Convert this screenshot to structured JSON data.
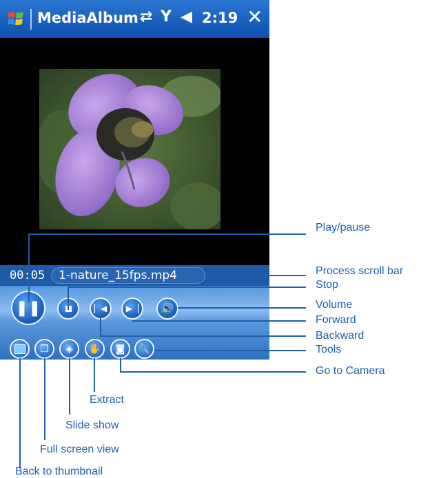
{
  "app": {
    "title": "MediaAlbum",
    "clock": "2:19",
    "close_label": "✕"
  },
  "status_icons": [
    "sync-disabled-icon",
    "signal-off-icon",
    "speaker-icon"
  ],
  "player": {
    "elapsed": "00:05",
    "filename": "1-nature_15fps.mp4"
  },
  "callouts": {
    "play_pause": "Play/pause",
    "scroll_bar": "Process scroll bar",
    "stop": "Stop",
    "volume": "Volume",
    "forward": "Forward",
    "backward": "Backward",
    "tools": "Tools",
    "camera": "Go to Camera",
    "extract": "Extract",
    "slideshow": "Slide show",
    "fullscreen": "Full screen view",
    "thumbnail": "Back to thumbnail"
  },
  "colors": {
    "titlebar": "#1a63c4",
    "callout": "#1f5fa8"
  }
}
